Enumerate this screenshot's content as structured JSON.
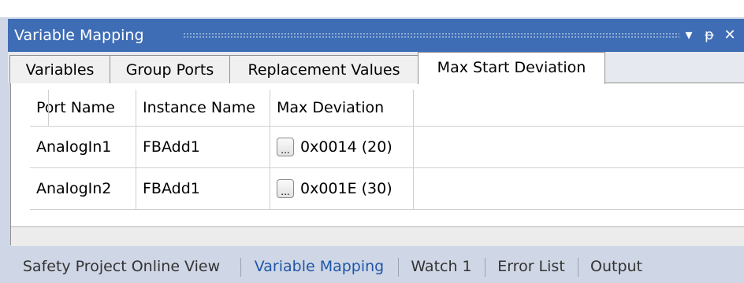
{
  "panel": {
    "title": "Variable Mapping",
    "controls": {
      "dropdown": "▾",
      "pin": "ᵽ",
      "close": "✕"
    }
  },
  "tabs": [
    {
      "label": "Variables"
    },
    {
      "label": "Group Ports"
    },
    {
      "label": "Replacement Values"
    },
    {
      "label": "Max Start Deviation",
      "active": true
    }
  ],
  "table": {
    "columns": [
      "Port Name",
      "Instance Name",
      "Max Deviation"
    ],
    "rows": [
      {
        "port": "AnalogIn1",
        "instance": "FBAdd1",
        "button": "...",
        "deviation": "0x0014 (20)"
      },
      {
        "port": "AnalogIn2",
        "instance": "FBAdd1",
        "button": "...",
        "deviation": "0x001E (30)"
      }
    ]
  },
  "bottom_tabs": [
    {
      "label": "Safety Project Online View"
    },
    {
      "label": "Variable Mapping",
      "active": true
    },
    {
      "label": "Watch 1"
    },
    {
      "label": "Error List"
    },
    {
      "label": "Output"
    }
  ],
  "colors": {
    "titlebar": "#3e6db5",
    "frame": "#cfd6e5",
    "active_tab_text": "#1f57a8"
  }
}
